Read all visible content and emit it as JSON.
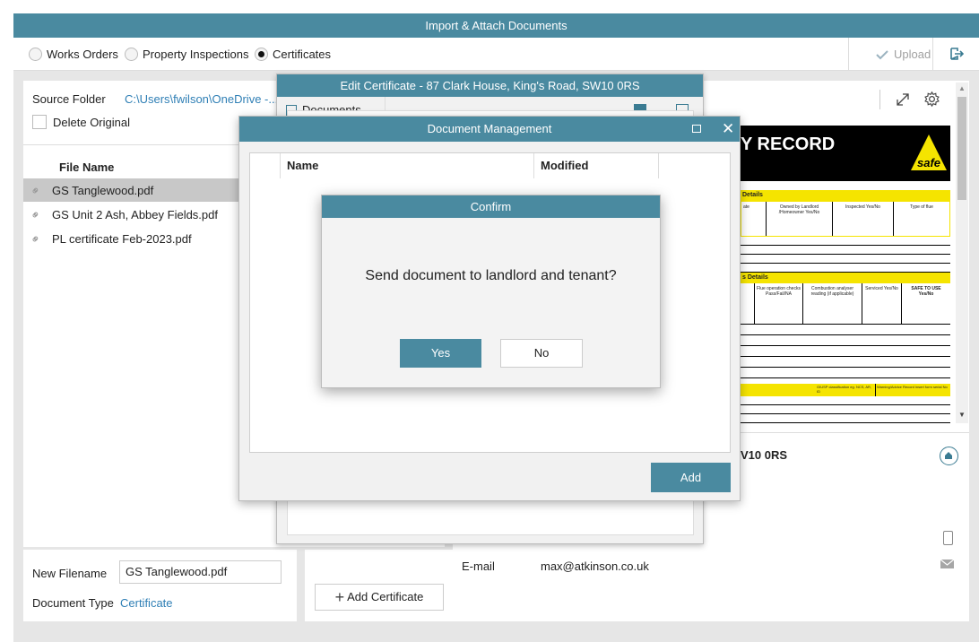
{
  "window": {
    "title": "Import & Attach Documents"
  },
  "toolbar": {
    "radios": [
      {
        "label": "Works Orders",
        "selected": false
      },
      {
        "label": "Property Inspections",
        "selected": false
      },
      {
        "label": "Certificates",
        "selected": true
      }
    ],
    "upload_label": "Upload"
  },
  "left": {
    "source_folder_label": "Source Folder",
    "source_folder_value": "C:\\Users\\fwilson\\OneDrive -...",
    "delete_original_label": "Delete Original",
    "file_name_header": "File Name",
    "files": [
      {
        "name": "GS Tanglewood.pdf",
        "selected": true
      },
      {
        "name": "GS Unit 2 Ash, Abbey Fields.pdf",
        "selected": false
      },
      {
        "name": "PL certificate Feb-2023.pdf",
        "selected": false
      }
    ],
    "new_filename_label": "New Filename",
    "new_filename_value": "GS Tanglewood.pdf",
    "document_type_label": "Document Type",
    "document_type_value": "Certificate"
  },
  "middle": {
    "add_certificate_label": "Add Certificate"
  },
  "right": {
    "address_fragment": "V10 0RS",
    "email_label": "E-mail",
    "email_value": "max@atkinson.co.uk",
    "cert_title": "Y RECORD",
    "cert_logo": "safe",
    "cert_section1": "Details",
    "cert_section2": "s Details",
    "cert_cols1": [
      "ate",
      "Owned by Landlord /Homeowner Yes/No",
      "Inspected Yes/No",
      "Type of flue"
    ],
    "cert_cols2": [
      "Flue operation checks Pass/Fail/NA",
      "Combustion analyser reading (if applicable)",
      "Serviced Yes/No",
      "SAFE TO USE Yes/No"
    ],
    "cert_cols3": [
      "GIUSP classification eg. NCS, AR, ID",
      "Warning/Advice Record insert form serial No"
    ]
  },
  "edit_dialog": {
    "title": "Edit Certificate - 87 Clark House, King's Road, SW10 0RS",
    "documents_label": "Documents"
  },
  "doc_dialog": {
    "title": "Document Management",
    "col_name": "Name",
    "col_modified": "Modified",
    "add_label": "Add"
  },
  "confirm": {
    "title": "Confirm",
    "message": "Send document to landlord and tenant?",
    "yes_label": "Yes",
    "no_label": "No"
  },
  "colors": {
    "accent": "#4a8aa0",
    "link": "#2f7fb5",
    "cert_yellow": "#f5e400"
  }
}
